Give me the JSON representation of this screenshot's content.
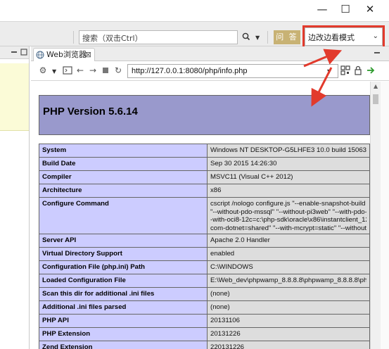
{
  "window": {
    "minimize_glyph": "—",
    "maximize_glyph": "☐",
    "close_glyph": "✕"
  },
  "toolbar": {
    "search_placeholder": "搜索（双击Ctrl）",
    "wenda_label": "问 答",
    "mode_select_value": "边改边看模式"
  },
  "editor": {
    "tab_label": "Web浏览器",
    "tab_close": "⊠"
  },
  "browser": {
    "url": "http://127.0.0.1:8080/php/info.php"
  },
  "page": {
    "header_title": "PHP Version 5.6.14",
    "rows": [
      {
        "key": "System",
        "value": [
          "Windows NT DESKTOP-G5LHFE3 10.0 build 15063"
        ]
      },
      {
        "key": "Build Date",
        "value": [
          "Sep 30 2015 14:26:30"
        ]
      },
      {
        "key": "Compiler",
        "value": [
          "MSVC11 (Visual C++ 2012)"
        ]
      },
      {
        "key": "Architecture",
        "value": [
          "x86"
        ]
      },
      {
        "key": "Configure Command",
        "value": [
          "cscript /nologo configure.js \"--enable-snapshot-build",
          "\"--without-pdo-mssql\" \"--without-pi3web\" \"--with-pdo-",
          "-with-oci8-12c=c:\\php-sdk\\oracle\\x86\\instantclient_12",
          "com-dotnet=shared\" \"--with-mcrypt=static\" \"--without-"
        ]
      },
      {
        "key": "Server API",
        "value": [
          "Apache 2.0 Handler"
        ]
      },
      {
        "key": "Virtual Directory Support",
        "value": [
          "enabled"
        ]
      },
      {
        "key": "Configuration File (php.ini) Path",
        "value": [
          "C:\\WINDOWS"
        ]
      },
      {
        "key": "Loaded Configuration File",
        "value": [
          "E:\\Web_dev\\phpwamp_8.8.8.8\\phpwamp_8.8.8.8\\ph"
        ]
      },
      {
        "key": "Scan this dir for additional .ini files",
        "value": [
          "(none)"
        ]
      },
      {
        "key": "Additional .ini files parsed",
        "value": [
          "(none)"
        ]
      },
      {
        "key": "PHP API",
        "value": [
          "20131106"
        ]
      },
      {
        "key": "PHP Extension",
        "value": [
          "20131226"
        ]
      },
      {
        "key": "Zend Extension",
        "value": [
          "220131226"
        ]
      }
    ]
  },
  "colors": {
    "annotation_red": "#e23a2c",
    "php_header": "#9999cc",
    "php_key_cell": "#ccccff",
    "php_value_cell": "#dddddd",
    "wenda_button": "#c8b274"
  },
  "icons": [
    "gear-icon",
    "terminal-icon",
    "back-arrow-icon",
    "forward-arrow-icon",
    "stop-icon",
    "refresh-icon",
    "search-icon",
    "qr-code-icon",
    "lock-icon",
    "go-arrow-icon",
    "globe-icon"
  ]
}
